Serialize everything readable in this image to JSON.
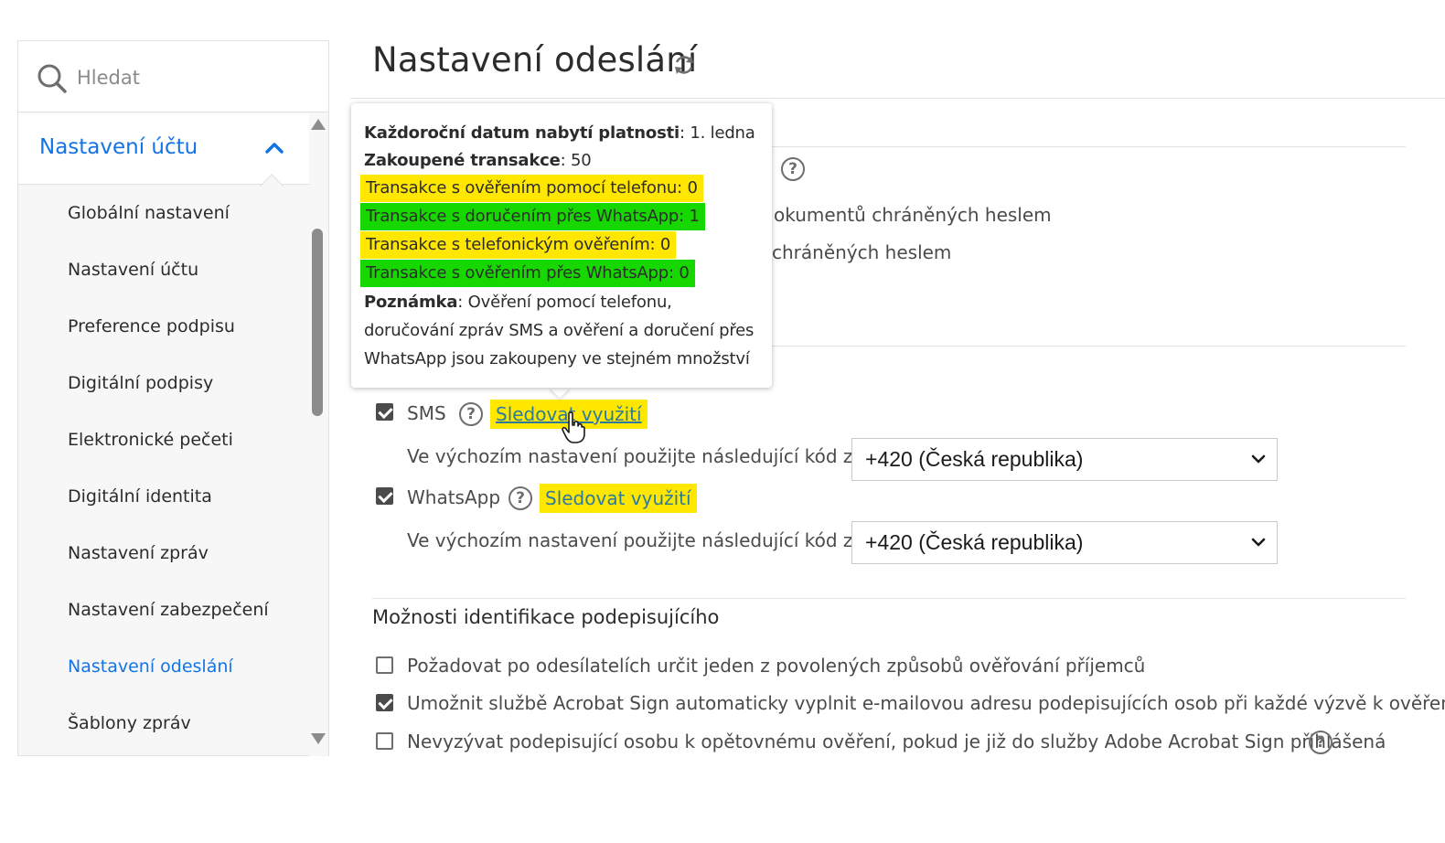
{
  "search": {
    "placeholder": "Hledat"
  },
  "sidebar": {
    "section_title": "Nastavení účtu",
    "items": [
      {
        "label": "Globální nastavení"
      },
      {
        "label": "Nastavení účtu"
      },
      {
        "label": "Preference podpisu"
      },
      {
        "label": "Digitální podpisy"
      },
      {
        "label": "Elektronické pečeti"
      },
      {
        "label": "Digitální identita"
      },
      {
        "label": "Nastavení zpráv"
      },
      {
        "label": "Nastavení zabezpečení"
      },
      {
        "label": "Nastavení odeslání"
      },
      {
        "label": "Šablony zpráv"
      }
    ],
    "active_index": 8
  },
  "page": {
    "title": "Nastavení odeslání"
  },
  "background_text": {
    "line1": "okumentů chráněných heslem",
    "line2": "chráněných heslem"
  },
  "tooltip": {
    "lines": [
      {
        "key": "Každoroční datum nabytí platnosti",
        "value": ": 1. ledna"
      },
      {
        "key": "Zakoupené transakce",
        "value": ": 50"
      },
      {
        "key": "Transakce s ověřením pomocí telefonu",
        "value": ": 0"
      },
      {
        "key": "Transakce s doručením přes WhatsApp",
        "value": ": 1"
      },
      {
        "key": "Transakce s telefonickým ověřením",
        "value": ": 0"
      },
      {
        "key": "Transakce s ověřením přes WhatsApp",
        "value": ": 0"
      }
    ],
    "note_key": "Poznámka",
    "note_text": ": Ověření pomocí telefonu, doručování zpráv SMS a ověření a doručení přes WhatsApp jsou zakoupeny ve stejném množství"
  },
  "delivery": {
    "sms": {
      "label": "SMS",
      "checked": true,
      "track_link": "Sledovat využití",
      "country_label": "Ve výchozím nastavení použijte následující kód země:",
      "country_value": "+420 (Česká republika)"
    },
    "whatsapp": {
      "label": "WhatsApp",
      "checked": true,
      "track_link": "Sledovat využití",
      "country_label": "Ve výchozím nastavení použijte následující kód země:",
      "country_value": "+420 (Česká republika)"
    }
  },
  "signer_identification": {
    "title": "Možnosti identifikace podepisujícího",
    "options": [
      {
        "label": "Požadovat po odesílatelích určit jeden z povolených způsobů ověřování příjemců",
        "checked": false
      },
      {
        "label": "Umožnit službě Acrobat Sign automaticky vyplnit e-mailovou adresu podepisujících osob při každé výzvě k ověření",
        "checked": true
      },
      {
        "label": "Nevyzývat podepisující osobu k opětovnému ověření, pokud je již do služby Adobe Acrobat Sign přihlášená",
        "checked": false
      }
    ]
  },
  "colors": {
    "accent": "#1473e6",
    "highlight_yellow": "#ffe700",
    "highlight_green": "#16d800",
    "link": "#2d7a9b"
  },
  "icons": [
    "search-icon",
    "chevron-up-icon",
    "refresh-icon",
    "help-icon",
    "chevron-down-icon",
    "hand-cursor-icon"
  ]
}
